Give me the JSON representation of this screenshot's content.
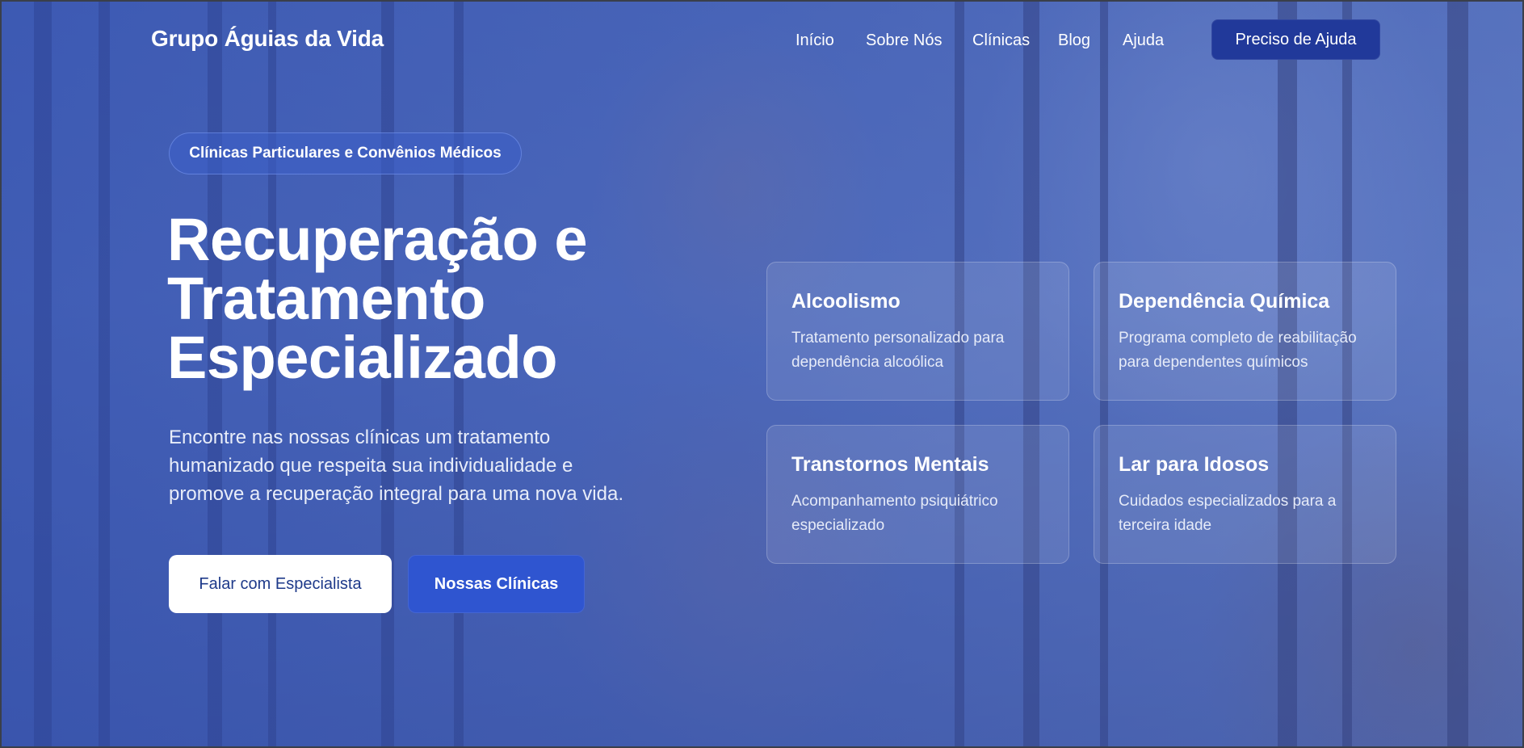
{
  "brand": "Grupo Águias da Vida",
  "nav": {
    "links": [
      "Início",
      "Sobre Nós",
      "Clínicas",
      "Blog",
      "Ajuda"
    ],
    "cta": "Preciso de Ajuda"
  },
  "hero": {
    "badge": "Clínicas Particulares e Convênios Médicos",
    "headline_lines": [
      "Recuperação e",
      "Tratamento",
      "Especializado"
    ],
    "subtext_lines": [
      "Encontre nas nossas clínicas um tratamento",
      "humanizado que respeita sua individualidade e",
      "promove a recuperação integral para uma nova vida."
    ],
    "primary_button": "Falar com Especialista",
    "secondary_button": "Nossas Clínicas"
  },
  "services": [
    {
      "title": "Alcoolismo",
      "desc_lines": [
        "Tratamento personalizado para",
        "dependência alcoólica"
      ]
    },
    {
      "title": "Dependência Química",
      "desc_lines": [
        "Programa completo de reabilitação",
        "para dependentes químicos"
      ]
    },
    {
      "title": "Transtornos Mentais",
      "desc_lines": [
        "Acompanhamento psiquiátrico",
        "especializado"
      ]
    },
    {
      "title": "Lar para Idosos",
      "desc_lines": [
        "Cuidados especializados para a",
        "terceira idade"
      ]
    }
  ],
  "colors": {
    "overlay": "#2846aa",
    "primary_button_text": "#1e3a8a",
    "secondary_button_bg": "#2f55d0",
    "top_cta_bg": "#21399a"
  }
}
